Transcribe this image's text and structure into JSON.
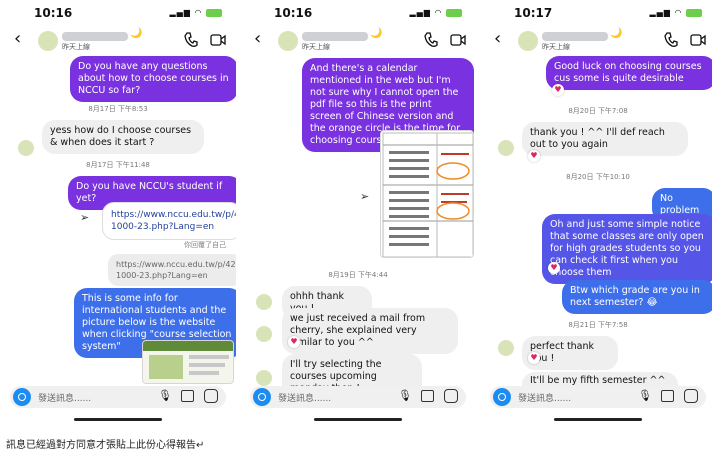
{
  "phones": [
    {
      "time": "10:16",
      "header_status": "昨天上線",
      "messages": {
        "m1": "Do you have any questions about how to choose courses in NCCU so far?",
        "t1": "8月17日 下午8:53",
        "m2": "yess how do I choose courses & when does it start ?",
        "t2": "8月17日 下午11:48",
        "m3": "Do you have NCCU's student if yet?",
        "link": "https://www.nccu.edu.tw/p/426-1000-23.php?Lang=en",
        "reply_note": "你回覆了自己",
        "quote": "https://www.nccu.edu.tw/p/426-1000-23.php?Lang=en",
        "m4": "This is some info for international students and the picture below is the website when clicking \"course selection system\""
      },
      "composer_placeholder": "發送訊息......"
    },
    {
      "time": "10:16",
      "header_status": "昨天上線",
      "messages": {
        "m1": "And there's a calendar mentioned in the web but I'm not sure why I cannot open the pdf file so this is the print screen of Chinese version and the orange circle is the time for choosing courses",
        "t1": "8月19日 下午4:44",
        "m2": "ohhh thank you !",
        "m3": "we just received a mail from cherry, she explained very similar to you ^^",
        "m4": "I'll try selecting the courses upcoming monday then !"
      },
      "composer_placeholder": "發送訊息......"
    },
    {
      "time": "10:17",
      "header_status": "昨天上線",
      "messages": {
        "m1": "Good luck on choosing courses cus some is quite desirable",
        "t1": "8月20日 下午7:08",
        "m2": "thank you ! ^^ I'll def reach out to you again",
        "t2": "8月20日 下午10:10",
        "m3": "No problem",
        "m4": "Oh and just some simple notice that some classes are only open for high grades students so you can check it first when you choose them",
        "m5": "Btw which grade are you in next semester? 😂",
        "t3": "8月21日 下午7:58",
        "m6": "perfect thank you !",
        "m7": "It'll be my fifth semester ^^ how"
      },
      "composer_placeholder": "發送訊息......"
    }
  ],
  "caption": "訊息已經過對方同意才張貼上此份心得報告↵"
}
